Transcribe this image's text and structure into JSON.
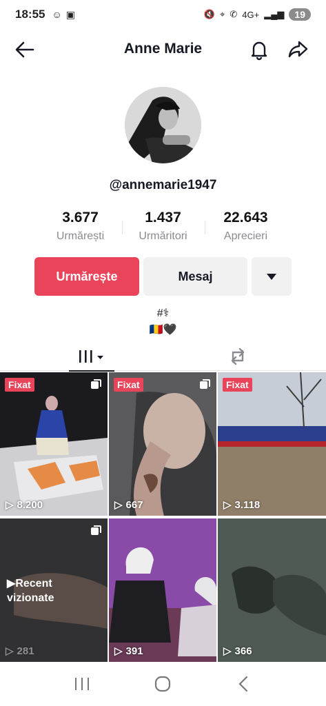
{
  "status_bar": {
    "time": "18:55",
    "battery": "19"
  },
  "header": {
    "title": "Anne Marie"
  },
  "profile": {
    "username": "@annemarie1947"
  },
  "stats": [
    {
      "value": "3.677",
      "label": "Urmărești"
    },
    {
      "value": "1.437",
      "label": "Urmăritori"
    },
    {
      "value": "22.643",
      "label": "Aprecieri"
    }
  ],
  "actions": {
    "follow": "Urmărește",
    "message": "Mesaj"
  },
  "bio": {
    "line1": "#⚕",
    "line2": "🇷🇴🖤"
  },
  "videos": [
    {
      "pinned": "Fixat",
      "views": "8.200"
    },
    {
      "pinned": "Fixat",
      "views": "667"
    },
    {
      "pinned": "Fixat",
      "views": "3.118"
    },
    {
      "recent": "Recent\nvizionate",
      "views": "281"
    },
    {
      "views": "391"
    },
    {
      "views": "366"
    }
  ],
  "colors": {
    "accent": "#ea445a",
    "muted": "#8a8b91"
  }
}
